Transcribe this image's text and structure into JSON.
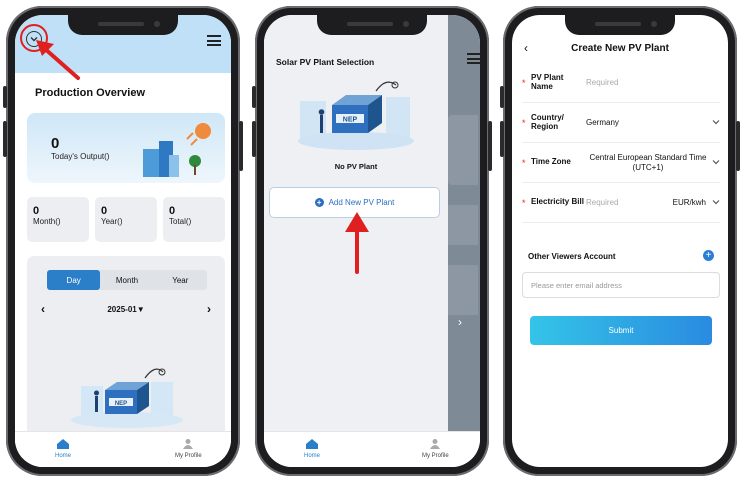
{
  "colors": {
    "accent": "#2b7fc8",
    "header_bg": "#bfe0f6",
    "annotation": "#e02020",
    "required_star": "#e22222"
  },
  "screen1": {
    "title": "Production Overview",
    "today": {
      "value": "0",
      "label": "Today's Output()"
    },
    "stats": [
      {
        "value": "0",
        "label": "Month()"
      },
      {
        "value": "0",
        "label": "Year()"
      },
      {
        "value": "0",
        "label": "Total()"
      }
    ],
    "period_tabs": [
      "Day",
      "Month",
      "Year"
    ],
    "active_tab": "Day",
    "date": "2025-01▼",
    "prev": "‹",
    "next": "›",
    "brand": "NEP",
    "nav": {
      "home": "Home",
      "profile": "My Profile"
    }
  },
  "screen2": {
    "title": "Solar PV Plant Selection",
    "brand": "NEP",
    "empty": "No PV Plant",
    "add_button": "Add New PV Plant",
    "overlay_chevron": "›",
    "nav": {
      "home": "Home",
      "profile": "My Profile"
    }
  },
  "screen3": {
    "back": "‹",
    "title": "Create New PV Plant",
    "fields": [
      {
        "label": "PV Plant Name",
        "placeholder": "Required",
        "value": "",
        "chevron": false
      },
      {
        "label": "Country/ Region",
        "placeholder": "",
        "value": "Germany",
        "chevron": true
      },
      {
        "label": "Time Zone",
        "placeholder": "",
        "value": "Central European Standard Time (UTC+1)",
        "chevron": true
      },
      {
        "label": "Electricity Bill",
        "placeholder": "Required",
        "value": "EUR/kwh",
        "chevron": true
      }
    ],
    "required_mark": "*",
    "other_viewers": "Other Viewers Account",
    "email_placeholder": "Please enter email address",
    "submit": "Submit"
  }
}
